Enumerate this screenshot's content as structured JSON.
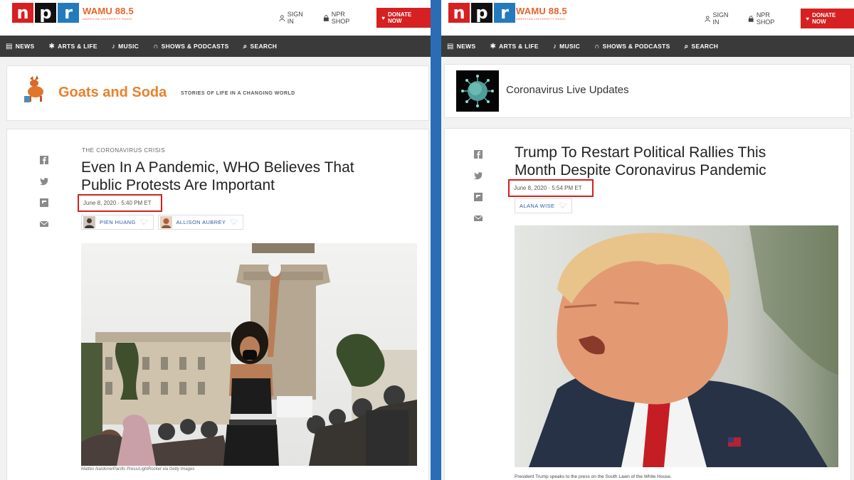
{
  "header": {
    "logo_letters": [
      "n",
      "p",
      "r"
    ],
    "station_name": "WAMU 88.5",
    "station_sub": "AMERICAN UNIVERSITY RADIO",
    "sign_in": "SIGN IN",
    "shop": "NPR SHOP",
    "donate": "DONATE NOW"
  },
  "nav": {
    "items": [
      "NEWS",
      "ARTS & LIFE",
      "MUSIC",
      "SHOWS & PODCASTS",
      "SEARCH"
    ]
  },
  "left": {
    "brand_title": "Goats and Soda",
    "brand_sub": "STORIES OF LIFE IN A CHANGING WORLD",
    "slug": "THE CORONAVIRUS CRISIS",
    "headline_line1": "Even In A Pandemic, WHO Believes That",
    "headline_line2": "Public Protests Are Important",
    "date": "June 8, 2020 · 5:40 PM ET",
    "authors": [
      "PIEN HUANG",
      "ALLISON AUBREY"
    ],
    "photo_credit": "Matteo Nardone/Pacific Press/LightRocket via Getty Images"
  },
  "right": {
    "brand_title": "Coronavirus Live Updates",
    "headline_line1": "Trump To Restart Political Rallies This",
    "headline_line2": "Month Despite Coronavirus Pandemic",
    "date": "June 8, 2020 · 5:54 PM ET",
    "authors": [
      "ALANA WISE"
    ],
    "caption": "President Trump speaks to the press on the South Lawn of the White House."
  },
  "colors": {
    "npr_red": "#d62021",
    "npr_blue": "#237bbd",
    "wamu_orange": "#e8642c",
    "divider_blue": "#2a6db5",
    "highlight_box": "#d62021"
  }
}
